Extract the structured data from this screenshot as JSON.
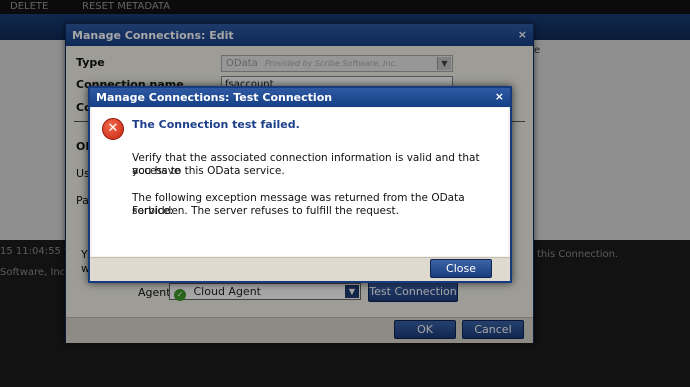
{
  "app": {
    "toolbar_delete": "DELETE",
    "toolbar_reset": "RESET METADATA",
    "right_edge_text": "e",
    "log_time": "15 11:04:55 f",
    "log_vendor": "Software, Inc.",
    "right_text_1": "n",
    "right_text_2": "this Connection."
  },
  "edit_dialog": {
    "title": "Manage Connections: Edit",
    "type_label": "Type",
    "type_value": "OData",
    "type_provider": "Provided by Scribe Software, Inc.",
    "connection_name_label": "Connection name",
    "connection_name_value": "fsaccount",
    "partial_labels": [
      "Co",
      "OD",
      "Us",
      "Pa",
      "Y",
      "w"
    ],
    "agent_label": "Agent",
    "agent_value": "Cloud Agent",
    "test_connection_button": "Test Connection",
    "ok_button": "OK",
    "cancel_button": "Cancel"
  },
  "test_dialog": {
    "title": "Manage Connections: Test Connection",
    "error_heading": "The Connection test failed.",
    "message_line1": "Verify that the associated connection information is valid and that you have",
    "message_line2": "access to this OData service.",
    "message_line3": "The following exception message was returned from the OData service:",
    "message_line4": "Forbidden. The server refuses to fulfill the request.",
    "close_button": "Close"
  },
  "colors": {
    "title_bar": "#1f4a94",
    "error_heading": "#1d3f8a",
    "error_icon": "#d9301a"
  }
}
